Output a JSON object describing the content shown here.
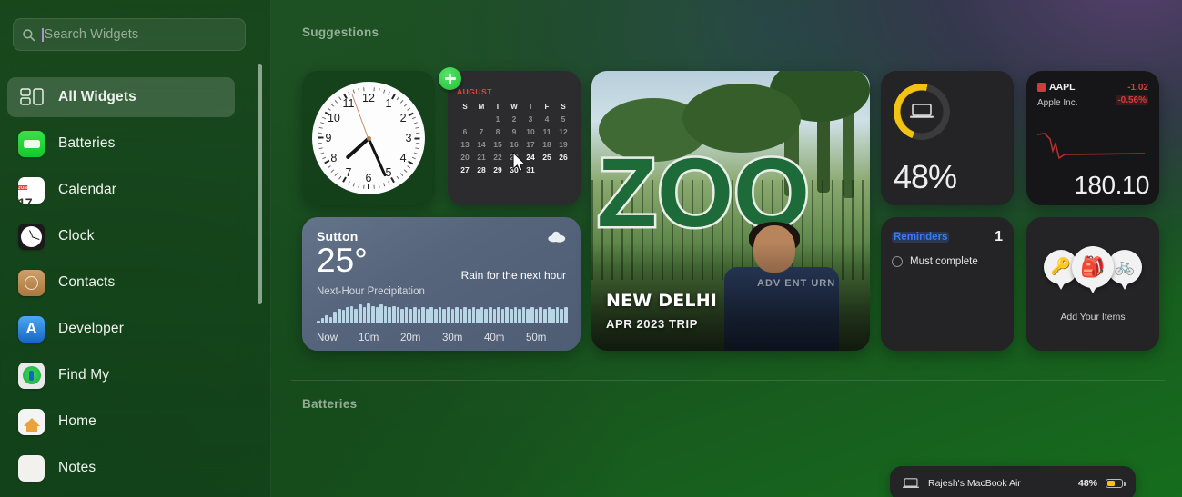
{
  "search": {
    "placeholder": "Search Widgets",
    "icon": "search-icon"
  },
  "sidebar": {
    "items": [
      {
        "label": "All Widgets",
        "icon": "all-widgets-icon",
        "active": true
      },
      {
        "label": "Batteries",
        "icon": "batteries-app-icon"
      },
      {
        "label": "Calendar",
        "icon": "calendar-app-icon",
        "badge_month": "JUN",
        "badge_day": "17"
      },
      {
        "label": "Clock",
        "icon": "clock-app-icon"
      },
      {
        "label": "Contacts",
        "icon": "contacts-app-icon"
      },
      {
        "label": "Developer",
        "icon": "developer-app-icon",
        "glyph": "A"
      },
      {
        "label": "Find My",
        "icon": "find-my-app-icon"
      },
      {
        "label": "Home",
        "icon": "home-app-icon"
      },
      {
        "label": "Notes",
        "icon": "notes-app-icon"
      }
    ]
  },
  "main": {
    "sections": [
      {
        "title": "Suggestions"
      },
      {
        "title": "Batteries"
      }
    ]
  },
  "widgets": {
    "clock": {
      "name": "Clock",
      "numbers": [
        "12",
        "1",
        "2",
        "3",
        "4",
        "5",
        "6",
        "7",
        "8",
        "9",
        "10",
        "11"
      ],
      "time": "7:26",
      "hour_deg": 228,
      "minute_deg": 156,
      "second_deg": 340
    },
    "calendar": {
      "name": "Calendar",
      "month": "AUGUST",
      "accent": "#e8453c",
      "weekdays": [
        "S",
        "M",
        "T",
        "W",
        "T",
        "F",
        "S"
      ],
      "leading_blanks": 2,
      "days": [
        1,
        2,
        3,
        4,
        5,
        6,
        7,
        8,
        9,
        10,
        11,
        12,
        13,
        14,
        15,
        16,
        17,
        18,
        19,
        20,
        21,
        22,
        23,
        24,
        25,
        26,
        27,
        28,
        29,
        30,
        31
      ],
      "today": 24,
      "add_button": "+"
    },
    "weather": {
      "name": "Weather",
      "city": "Sutton",
      "temperature": "25°",
      "condition": "Rain for the next hour",
      "condition_prefix": "Rain",
      "chart_label": "Next-Hour Precipitation",
      "time_labels": [
        "Now",
        "10m",
        "20m",
        "30m",
        "40m",
        "50m"
      ],
      "icon": "cloud-icon"
    },
    "photo": {
      "name": "Photos",
      "title": "NEW DELHI",
      "subtitle": "APR 2023 TRIP",
      "sign_text": "ZOO",
      "shirt_text": "ADV ENT URN"
    },
    "battery": {
      "name": "Batteries",
      "percent": "48%",
      "percent_value": 48,
      "ring_color": "#f2c313",
      "icon": "laptop-icon"
    },
    "stocks": {
      "name": "Stocks",
      "ticker": "AAPL",
      "company": "Apple Inc.",
      "change": "-1.02",
      "change_percent": "-0.56%",
      "price": "180.10",
      "negative_color": "#d83c3c"
    },
    "reminders": {
      "name": "Reminders",
      "title": "Reminders",
      "title_color": "#3b7bf0",
      "count": "1",
      "items": [
        {
          "text": "Must complete",
          "done": false
        }
      ]
    },
    "items": {
      "name": "Find My Items",
      "label": "Add Your Items",
      "pins": [
        "🔑",
        "🎒",
        "🚲"
      ]
    },
    "battery_row": {
      "name": "Rajesh's MacBook Air",
      "percent": "48%",
      "percent_value": 48,
      "icon": "laptop-icon"
    }
  },
  "chart_data": {
    "type": "bar",
    "title": "Next-Hour Precipitation",
    "xlabel": "",
    "ylabel": "",
    "categories": [
      "Now",
      "10m",
      "20m",
      "30m",
      "40m",
      "50m"
    ],
    "x": [
      0,
      1,
      2,
      3,
      4,
      5,
      6,
      7,
      8,
      9,
      10,
      11,
      12,
      13,
      14,
      15,
      16,
      17,
      18,
      19,
      20,
      21,
      22,
      23,
      24,
      25,
      26,
      27,
      28,
      29,
      30,
      31,
      32,
      33,
      34,
      35,
      36,
      37,
      38,
      39,
      40,
      41,
      42,
      43,
      44,
      45,
      46,
      47,
      48,
      49,
      50,
      51,
      52,
      53,
      54,
      55,
      56,
      57,
      58,
      59
    ],
    "values": [
      2,
      4,
      6,
      5,
      9,
      11,
      10,
      12,
      13,
      11,
      14,
      12,
      15,
      13,
      12,
      14,
      13,
      12,
      13,
      12,
      11,
      12,
      11,
      12,
      11,
      12,
      11,
      12,
      11,
      12,
      11,
      12,
      11,
      12,
      11,
      12,
      11,
      12,
      11,
      12,
      11,
      12,
      11,
      12,
      11,
      12,
      11,
      12,
      11,
      12,
      11,
      12,
      11,
      12,
      11,
      12,
      11,
      12,
      11,
      12
    ],
    "ylim": [
      0,
      16
    ],
    "grid": false,
    "legend": "none",
    "bar_color": "#b9d6e6"
  }
}
